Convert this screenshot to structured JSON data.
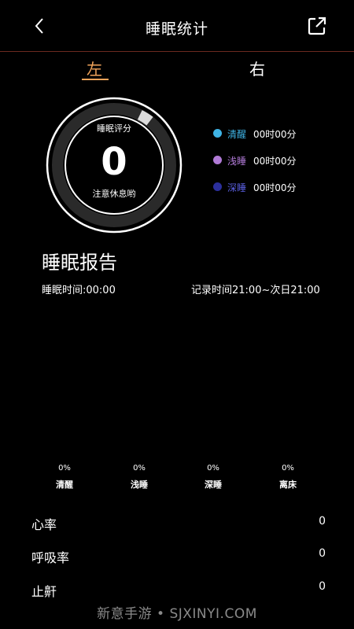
{
  "header": {
    "title": "睡眠统计"
  },
  "tabs": {
    "left": "左",
    "right": "右",
    "active": "left"
  },
  "score": {
    "label": "睡眠评分",
    "value": "0",
    "hint": "注意休息哟"
  },
  "legend": [
    {
      "name": "清醒",
      "value": "00时00分",
      "color": "#3fb4e6"
    },
    {
      "name": "浅睡",
      "value": "00时00分",
      "color": "#b07ad6"
    },
    {
      "name": "深睡",
      "value": "00时00分",
      "color": "#2b2f9c"
    }
  ],
  "report": {
    "title": "睡眠报告",
    "sleep_time": "睡眠时间:00:00",
    "record_time": "记录时间21:00~次日21:00"
  },
  "stats": [
    {
      "pct": "0%",
      "label": "清醒"
    },
    {
      "pct": "0%",
      "label": "浅睡"
    },
    {
      "pct": "0%",
      "label": "深睡"
    },
    {
      "pct": "0%",
      "label": "离床"
    }
  ],
  "rows": [
    {
      "label": "心率",
      "value": "0"
    },
    {
      "label": "呼吸率",
      "value": "0"
    },
    {
      "label": "止鼾",
      "value": "0"
    }
  ],
  "watermark": "新意手游 • SJXINYI.COM",
  "colors": {
    "accent": "#f0a35a",
    "header_line": "#6b2a20"
  }
}
